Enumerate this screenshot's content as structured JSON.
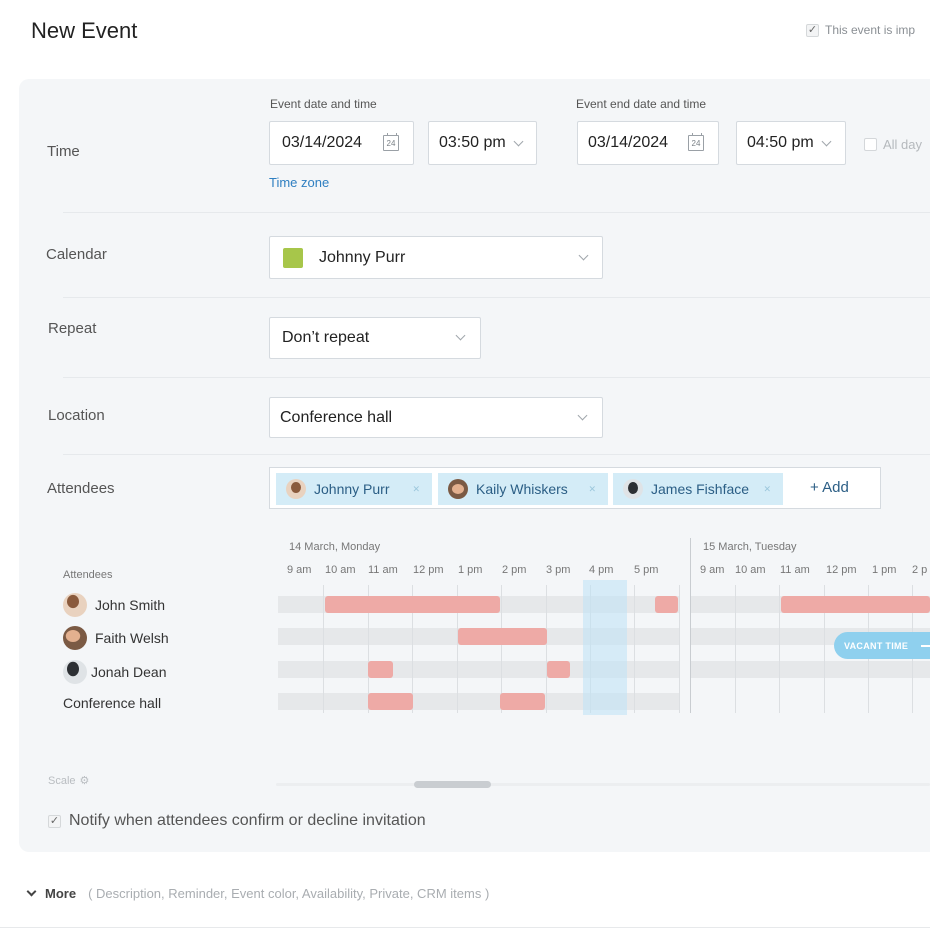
{
  "header": {
    "title": "New Event",
    "important_label": "This event is imp"
  },
  "time": {
    "label": "Time",
    "start_label": "Event date and time",
    "start_date": "03/14/2024",
    "start_time": "03:50 pm",
    "end_label": "Event end date and time",
    "end_date": "03/14/2024",
    "end_time": "04:50 pm",
    "all_day": "All day",
    "time_zone": "Time zone",
    "calendar_icon_text": "24"
  },
  "calendar": {
    "label": "Calendar",
    "value": "Johnny Purr",
    "swatch_color": "#a7c64a"
  },
  "repeat": {
    "label": "Repeat",
    "value": "Don’t repeat"
  },
  "location": {
    "label": "Location",
    "value": "Conference hall"
  },
  "attendees": {
    "label": "Attendees",
    "chips": [
      "Johnny Purr",
      "Kaily Whiskers",
      "James Fishface"
    ],
    "add_label": "+ Add"
  },
  "schedule": {
    "day1": "14 March, Monday",
    "day2": "15 March, Tuesday",
    "rows_header": "Attendees",
    "ticks_day1": [
      "9 am",
      "10 am",
      "11 am",
      "12 pm",
      "1 pm",
      "2 pm",
      "3 pm",
      "4 pm",
      "5 pm"
    ],
    "ticks_day2": [
      "9 am",
      "10 am",
      "11 am",
      "12 pm",
      "1 pm",
      "2 p"
    ],
    "rows": [
      "John Smith",
      "Faith Welsh",
      "Jonah Dean",
      "Conference hall"
    ],
    "vacant_label": "VACANT TIME",
    "busy_color": "#eeaaa6",
    "vacant_color": "#8fd0ee"
  },
  "scale_label": "Scale",
  "notify_label": "Notify when attendees confirm or decline invitation",
  "more": {
    "label": "More",
    "hint": "( Description, Reminder, Event color, Availability, Private, CRM items )"
  }
}
